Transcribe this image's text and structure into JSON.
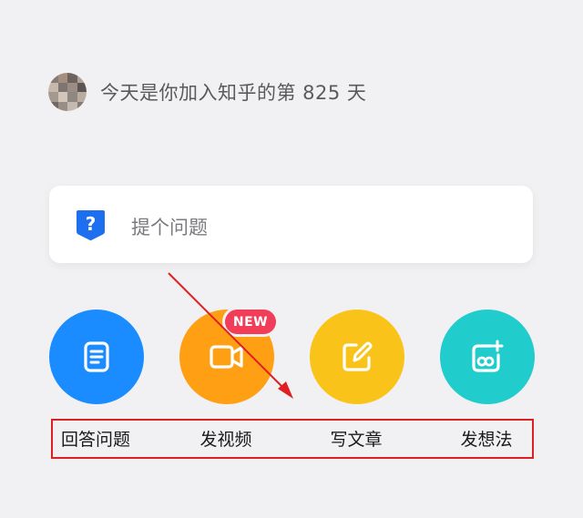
{
  "profile": {
    "greeting": "今天是你加入知乎的第 825 天"
  },
  "ask": {
    "icon": "question-shield-icon",
    "placeholder": "提个问题"
  },
  "actions": [
    {
      "label": "回答问题",
      "icon": "document-icon",
      "color": "#1a8cff"
    },
    {
      "label": "发视频",
      "icon": "video-camera-icon",
      "color": "#ff9f14",
      "badge": "NEW"
    },
    {
      "label": "写文章",
      "icon": "edit-pencil-icon",
      "color": "#f9c31a"
    },
    {
      "label": "发想法",
      "icon": "image-add-icon",
      "color": "#21cccc"
    }
  ],
  "annotation": {
    "color": "#e02020"
  }
}
